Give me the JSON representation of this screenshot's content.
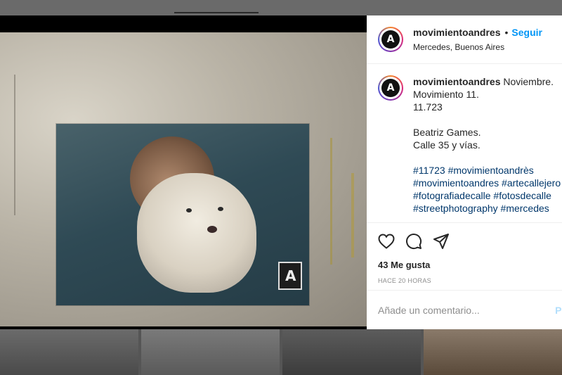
{
  "post": {
    "username": "movimientoandres",
    "follow_label": "Seguir",
    "dot": "•",
    "location": "Mercedes, Buenos Aires",
    "logo_letter": "A"
  },
  "caption": {
    "username": "movimientoandres",
    "lines": [
      "Noviembre.",
      "Movimiento 11.",
      "11.723",
      "Beatriz Games.",
      "Calle 35 y vías."
    ],
    "hashtag_lines": [
      "#11723 #movimientoandrès",
      "#movimientoandres #artecallejero",
      "#fotografiadecalle #fotosdecalle",
      "#streetphotography #mercedes"
    ]
  },
  "actions": {
    "like_icon": "heart-icon",
    "comment_icon": "comment-bubble-icon",
    "share_icon": "paper-plane-icon"
  },
  "likes_text": "43 Me gusta",
  "timestamp": "HACE 20 HORAS",
  "comment_input": {
    "placeholder": "Añade un comentario...",
    "post_label": "Pu"
  },
  "colors": {
    "accent": "#0095f6",
    "hashtag": "#00376b",
    "muted": "#8e8e8e"
  }
}
